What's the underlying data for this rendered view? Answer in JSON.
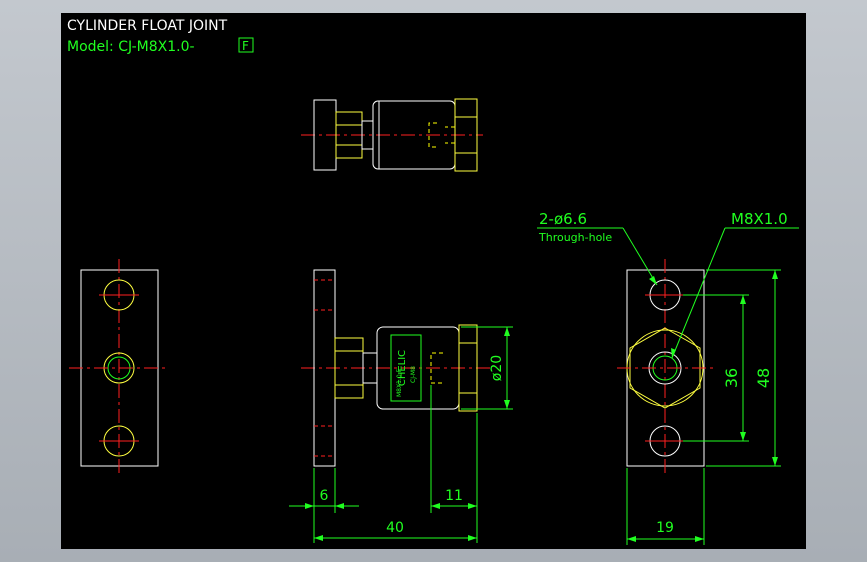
{
  "title": "CYLINDER FLOAT JOINT",
  "model": {
    "prefix": "Model: CJ-M8X1.0-",
    "boxed_letter": "F"
  },
  "brand_label": "CHELIC",
  "body_marks": [
    "CJ-M8",
    "M8X1.0 F"
  ],
  "annotations": {
    "hole_spec": "2-ø6.6",
    "hole_note": "Through-hole",
    "thread_spec": "M8X1.0"
  },
  "dimensions": {
    "flange_thickness": "6",
    "thread_length": "11",
    "overall_length": "40",
    "body_diameter": "ø20",
    "hole_pitch": "36",
    "flange_height": "48",
    "flange_width": "19"
  },
  "colors": {
    "background": "#000000",
    "outline": "#ffffff",
    "centerline": "#ff2020",
    "dimension": "#20ff20",
    "hidden": "#ffff00",
    "nut": "#ffff40"
  }
}
